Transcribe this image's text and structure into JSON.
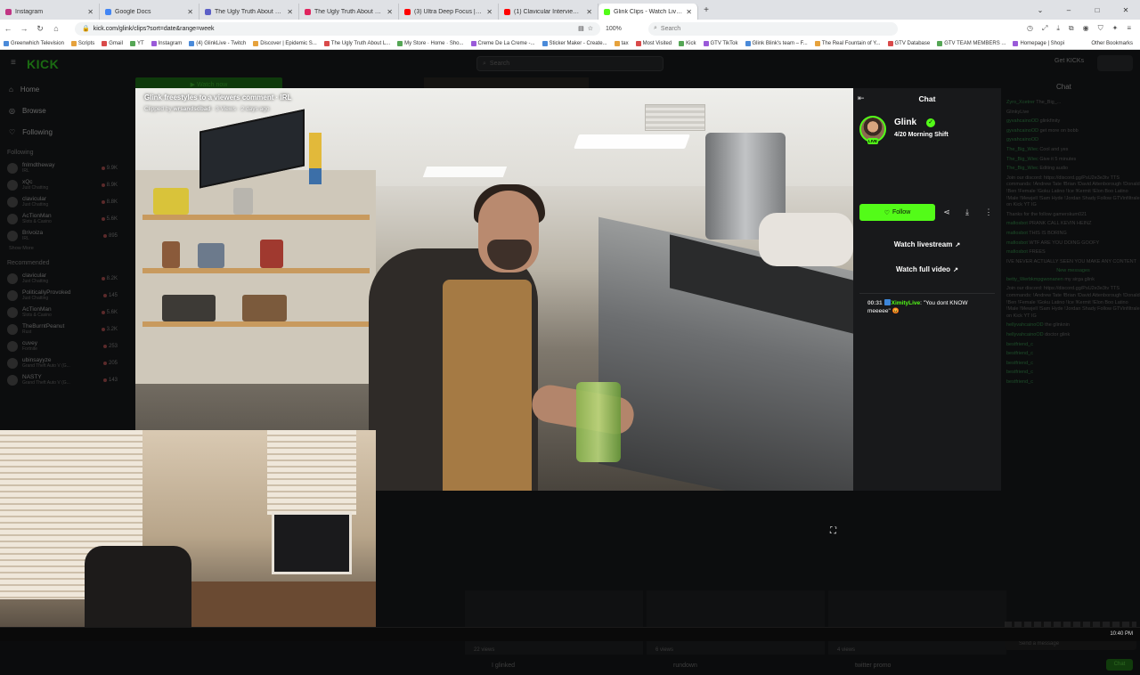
{
  "browser": {
    "tabs": [
      {
        "title": "Instagram",
        "color": "#c13584",
        "active": false
      },
      {
        "title": "Google Docs",
        "color": "#4285f4",
        "active": false
      },
      {
        "title": "The Ugly Truth About Lookismo",
        "color": "#5b5fc7",
        "active": false
      },
      {
        "title": "The Ugly Truth About Lookismo",
        "color": "#e0245e",
        "active": false
      },
      {
        "title": "(3) Ultra Deep Focus | 40Hz Gar",
        "color": "#ff0000",
        "active": false
      },
      {
        "title": "(1) Clavicular Interview - YouTub",
        "color": "#ff0000",
        "active": false
      },
      {
        "title": "Glink Clips - Watch Live on Kick",
        "color": "#53fc18",
        "active": true
      }
    ],
    "new_tab": "+",
    "window_controls": [
      "–",
      "□",
      "✕"
    ],
    "url": "kick.com/glink/clips?sort=date&range=week",
    "zoom": "100%",
    "search_placeholder": "Search",
    "bookmarks": [
      "Greenwhich Television",
      "Scripts",
      "Gmail",
      "YT",
      "Instagram",
      "(4) GlinkLive - Twitch",
      "Discover | Epidemic S...",
      "The Ugly Truth About L...",
      "My Store · Home · Sho...",
      "Creme De La Creme -...",
      "Sticker Maker - Create...",
      "tax",
      "Most Visited",
      "Kick",
      "GTV TikTok",
      "Glink Blink's team – F...",
      "The Real Fountain of Y...",
      "GTV Database",
      "GTV TEAM MEMBERS ...",
      "Homepage | Shopi"
    ],
    "bookmarks_right": "Other Bookmarks"
  },
  "kick": {
    "logo": "KICK",
    "search_placeholder": "Search",
    "get_kicks": "Get KICKs",
    "nav": [
      "Home",
      "Browse",
      "Following"
    ],
    "following_header": "Following",
    "following": [
      {
        "name": "fnlmdtheway",
        "sub": "IRL",
        "count": "9.9K"
      },
      {
        "name": "xQc",
        "sub": "Just Chatting",
        "count": "8.9K"
      },
      {
        "name": "clavicular",
        "sub": "Just Chatting",
        "count": "8.8K"
      },
      {
        "name": "AcTionMan",
        "sub": "Slots & Casino",
        "count": "5.6K"
      },
      {
        "name": "Brivoiza",
        "sub": "IRL",
        "count": "895"
      }
    ],
    "show_more": "Show More",
    "recommended_header": "Recommended",
    "recommended": [
      {
        "name": "clavicular",
        "sub": "Just Chatting",
        "count": "8.2K"
      },
      {
        "name": "PoliticallyProvoked",
        "sub": "Just Chatting",
        "count": "145"
      },
      {
        "name": "AcTionMan",
        "sub": "Slots & Casino",
        "count": "5.6K"
      },
      {
        "name": "TheBurntPeanut",
        "sub": "Rust",
        "count": "3.2K"
      },
      {
        "name": "cuvey",
        "sub": "Fortnite",
        "count": "253"
      },
      {
        "name": "ubinsayyze",
        "sub": "Grand Theft Auto V (G...",
        "count": "205"
      },
      {
        "name": "NASTY",
        "sub": "Grand Theft Auto V (G...",
        "count": "143"
      }
    ],
    "watch_now": "Watch now",
    "chat_title": "Chat",
    "bg_chat": [
      {
        "user": "Zyro_Xcetrer",
        "text": "The_Big_..."
      },
      {
        "user": "",
        "text": "GlinkyLive"
      },
      {
        "user": "gyvahcainoOD",
        "text": "glinkfinity"
      },
      {
        "user": "gyvahcainoOD",
        "text": "get more on bobb"
      },
      {
        "user": "gyvahcainoOD",
        "text": ""
      },
      {
        "user": "The_Big_Wiec",
        "text": "Cool and yes"
      },
      {
        "user": "The_Big_Wiec",
        "text": "Give it 5 minutes"
      },
      {
        "user": "The_Big_Wiec",
        "text": "Editing audio"
      },
      {
        "user": "",
        "text": "Join our discord: https://discord.gg/PsU2e3e3tv TTS commands: !Andrew Tate !Brian !David Attenborough !Donald !Ben !Female !Goku Latino !Ice !Kermit !Elon Boo Latino !Male !Mewjell !Sam Hyde !Jordan Shady Follow GTVinfiltrale on Kick YT IG"
      },
      {
        "user": "",
        "text": "Thanks for the follow gamerskum021"
      },
      {
        "user": "mafiosbot",
        "text": "PRANK CALL KEVIN HEINZ"
      },
      {
        "user": "mafiosbot",
        "text": "THIS IS BORING"
      },
      {
        "user": "mafiosbot",
        "text": "WTF ARE YOU DOING GOOFY"
      },
      {
        "user": "mafiosbot",
        "text": "FREES"
      },
      {
        "user": "",
        "text": "IVE NEVER ACTUALLY SEEN YOU MAKE ANY CONTENT"
      },
      {
        "user": "",
        "text": "New messages"
      },
      {
        "user": "betty_Werbkmpgwonanen",
        "text": "my sirga glink"
      },
      {
        "user": "",
        "text": "Join our discord: https://discord.gg/PsU2e3e3tv TTS commands: !Andrew Tate !Brian !David Attenborough !Donald !Ben !Female !Goku Latino !Ice !Kermit !Elon Boo Latino !Male !Mewjell !Sam Hyde !Jordan Shady Follow GTVinfiltrale on Kick YT IG"
      },
      {
        "user": "hellyvahcainoOD",
        "text": "the glinknin"
      },
      {
        "user": "hellyvahcainoOD",
        "text": "doctor glink"
      },
      {
        "user": "bestfriend_c",
        "text": ""
      },
      {
        "user": "bestfriend_c",
        "text": ""
      },
      {
        "user": "bestfriend_c",
        "text": ""
      },
      {
        "user": "bestfriend_c",
        "text": ""
      },
      {
        "user": "bestfriend_c",
        "text": ""
      }
    ],
    "send_placeholder": "Send a message",
    "chat_button": "Chat",
    "bottom_clips": [
      {
        "views": "22 views",
        "title": "I glinked"
      },
      {
        "views": "6 views",
        "title": "rundown"
      },
      {
        "views": "4 views",
        "title": "twitter promo"
      }
    ]
  },
  "clip": {
    "title": "Glink freestyles to a viewers comment · IRL",
    "meta_prefix": "Clipped by",
    "clipper": "wrsandsdbad",
    "meta_rest": "· 3 Views · 2 days ago",
    "progress": 1.0
  },
  "panel": {
    "title": "Chat",
    "streamer": "Glink",
    "live": "LIVE",
    "stream_title": "4/20 Morning Shift",
    "follow": "Follow",
    "watch_livestream": "Watch livestream",
    "watch_full_video": "Watch full video",
    "message": {
      "time": "00:31",
      "user": "XimityLive",
      "text": "\"You dont KNOW meeeee\" 😡"
    }
  },
  "taskbar": {
    "clock": "10:40 PM"
  },
  "colors": {
    "kick_green": "#53fc18",
    "panel_bg": "#18191b"
  }
}
